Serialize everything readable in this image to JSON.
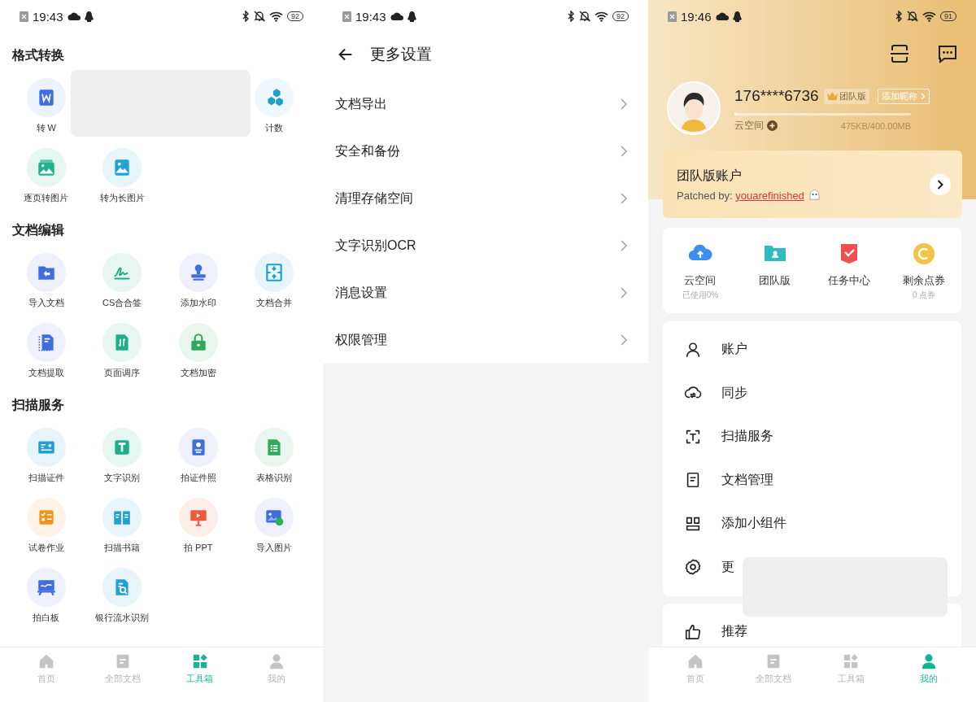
{
  "toolbox_screen": {
    "status_bar": {
      "time": "19:43",
      "battery": "92"
    },
    "sections": [
      {
        "title": "格式转换",
        "items": [
          {
            "kind": "word",
            "label": "转 W"
          },
          {
            "kind": "redacted"
          },
          {
            "kind": "hexagons",
            "label": "计数"
          },
          {
            "kind": "pages-image",
            "label": "逐页转图片"
          },
          {
            "kind": "long-image",
            "label": "转为长图片"
          }
        ]
      },
      {
        "title": "文档编辑",
        "items": [
          {
            "kind": "import-folder",
            "label": "导入文档"
          },
          {
            "kind": "signature",
            "label": "CS合合签"
          },
          {
            "kind": "stamp",
            "label": "添加水印"
          },
          {
            "kind": "merge",
            "label": "文档合并"
          },
          {
            "kind": "extract",
            "label": "文档提取"
          },
          {
            "kind": "reorder",
            "label": "页面调序"
          },
          {
            "kind": "lock",
            "label": "文档加密"
          }
        ]
      },
      {
        "title": "扫描服务",
        "items": [
          {
            "kind": "id-card",
            "label": "扫描证件"
          },
          {
            "kind": "text",
            "label": "文字识别"
          },
          {
            "kind": "id-photo",
            "label": "拍证件照"
          },
          {
            "kind": "table",
            "label": "表格识别"
          },
          {
            "kind": "homework",
            "label": "试卷作业"
          },
          {
            "kind": "book",
            "label": "扫描书籍"
          },
          {
            "kind": "presentation",
            "label": "拍 PPT"
          },
          {
            "kind": "import-image",
            "label": "导入图片"
          },
          {
            "kind": "whiteboard",
            "label": "拍白板"
          },
          {
            "kind": "bank-statement",
            "label": "银行流水识别"
          }
        ]
      }
    ],
    "tabs": [
      {
        "kind": "home",
        "label": "首页",
        "selected": false
      },
      {
        "kind": "documents",
        "label": "全部文档",
        "selected": false
      },
      {
        "kind": "toolbox",
        "label": "工具箱",
        "selected": true
      },
      {
        "kind": "me",
        "label": "我的",
        "selected": false
      }
    ]
  },
  "settings_screen": {
    "status_bar": {
      "time": "19:43",
      "battery": "92"
    },
    "title": "更多设置",
    "items": [
      {
        "label": "文档导出"
      },
      {
        "label": "安全和备份"
      },
      {
        "label": "清理存储空间"
      },
      {
        "label": "文字识别OCR"
      },
      {
        "label": "消息设置"
      },
      {
        "label": "权限管理"
      }
    ]
  },
  "profile_screen": {
    "status_bar": {
      "time": "19:46",
      "battery": "91"
    },
    "user": {
      "phone": "176****6736",
      "badge": "团队版",
      "nickname_button": "添加昵称",
      "storage_label": "云空间",
      "storage_used": "475KB/400.00MB",
      "level": 0.01
    },
    "team_card": {
      "title": "团队版账户",
      "patch_text": "Patched by:",
      "link": "youarefinished"
    },
    "quick_actions": [
      {
        "kind": "cloud",
        "label": "云空间",
        "sublabel": "已使用0%"
      },
      {
        "kind": "team",
        "label": "团队版"
      },
      {
        "kind": "tasks",
        "label": "任务中心"
      },
      {
        "kind": "coupon",
        "label": "剩余点券",
        "sublabel": "0 点券"
      }
    ],
    "menu": [
      {
        "kind": "account",
        "label": "账户",
        "covered": false
      },
      {
        "kind": "sync",
        "label": "同步",
        "covered": false
      },
      {
        "kind": "scan",
        "label": "扫描服务",
        "covered": false
      },
      {
        "kind": "document",
        "label": "文档管理",
        "covered": false
      },
      {
        "kind": "widget",
        "label": "添加小组件",
        "covered": false
      },
      {
        "kind": "settings",
        "label": "更",
        "covered": true
      }
    ],
    "menu_2": [
      {
        "kind": "recommend",
        "label": "推荐",
        "covered": false
      }
    ],
    "tabs": [
      {
        "kind": "home",
        "label": "首页",
        "selected": false
      },
      {
        "kind": "documents",
        "label": "全部文档",
        "selected": false
      },
      {
        "kind": "toolbox",
        "label": "工具箱",
        "selected": false
      },
      {
        "kind": "me",
        "label": "我的",
        "selected": true
      }
    ]
  }
}
